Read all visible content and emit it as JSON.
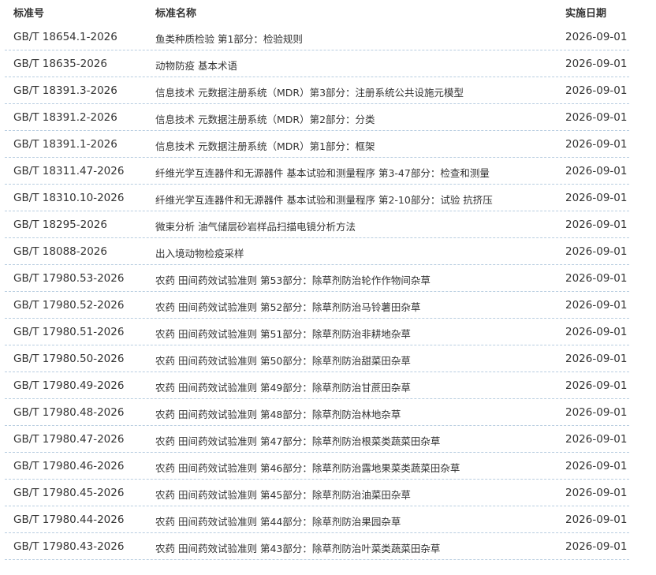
{
  "table": {
    "headers": {
      "standard_no": "标准号",
      "standard_name": "标准名称",
      "effective_date": "实施日期"
    },
    "rows": [
      {
        "no": "GB/T 18654.1-2026",
        "name": "鱼类种质检验 第1部分：检验规则",
        "date": "2026-09-01"
      },
      {
        "no": "GB/T 18635-2026",
        "name": "动物防疫 基本术语",
        "date": "2026-09-01"
      },
      {
        "no": "GB/T 18391.3-2026",
        "name": "信息技术 元数据注册系统（MDR）第3部分：注册系统公共设施元模型",
        "date": "2026-09-01"
      },
      {
        "no": "GB/T 18391.2-2026",
        "name": "信息技术 元数据注册系统（MDR）第2部分：分类",
        "date": "2026-09-01"
      },
      {
        "no": "GB/T 18391.1-2026",
        "name": "信息技术 元数据注册系统（MDR）第1部分：框架",
        "date": "2026-09-01"
      },
      {
        "no": "GB/T 18311.47-2026",
        "name": "纤维光学互连器件和无源器件 基本试验和测量程序 第3-47部分：检查和测量",
        "date": "2026-09-01"
      },
      {
        "no": "GB/T 18310.10-2026",
        "name": "纤维光学互连器件和无源器件 基本试验和测量程序 第2-10部分：试验 抗挤压",
        "date": "2026-09-01"
      },
      {
        "no": "GB/T 18295-2026",
        "name": "微束分析 油气储层砂岩样品扫描电镜分析方法",
        "date": "2026-09-01"
      },
      {
        "no": "GB/T 18088-2026",
        "name": "出入境动物检疫采样",
        "date": "2026-09-01"
      },
      {
        "no": "GB/T 17980.53-2026",
        "name": "农药 田间药效试验准则 第53部分：除草剂防治轮作作物间杂草",
        "date": "2026-09-01"
      },
      {
        "no": "GB/T 17980.52-2026",
        "name": "农药 田间药效试验准则 第52部分：除草剂防治马铃薯田杂草",
        "date": "2026-09-01"
      },
      {
        "no": "GB/T 17980.51-2026",
        "name": "农药 田间药效试验准则 第51部分：除草剂防治非耕地杂草",
        "date": "2026-09-01"
      },
      {
        "no": "GB/T 17980.50-2026",
        "name": "农药 田间药效试验准则 第50部分：除草剂防治甜菜田杂草",
        "date": "2026-09-01"
      },
      {
        "no": "GB/T 17980.49-2026",
        "name": "农药 田间药效试验准则 第49部分：除草剂防治甘蔗田杂草",
        "date": "2026-09-01"
      },
      {
        "no": "GB/T 17980.48-2026",
        "name": "农药 田间药效试验准则 第48部分：除草剂防治林地杂草",
        "date": "2026-09-01"
      },
      {
        "no": "GB/T 17980.47-2026",
        "name": "农药 田间药效试验准则 第47部分：除草剂防治根菜类蔬菜田杂草",
        "date": "2026-09-01"
      },
      {
        "no": "GB/T 17980.46-2026",
        "name": "农药 田间药效试验准则 第46部分：除草剂防治露地果菜类蔬菜田杂草",
        "date": "2026-09-01"
      },
      {
        "no": "GB/T 17980.45-2026",
        "name": "农药 田间药效试验准则 第45部分：除草剂防治油菜田杂草",
        "date": "2026-09-01"
      },
      {
        "no": "GB/T 17980.44-2026",
        "name": "农药 田间药效试验准则 第44部分：除草剂防治果园杂草",
        "date": "2026-09-01"
      },
      {
        "no": "GB/T 17980.43-2026",
        "name": "农药 田间药效试验准则 第43部分：除草剂防治叶菜类蔬菜田杂草",
        "date": "2026-09-01"
      }
    ]
  }
}
